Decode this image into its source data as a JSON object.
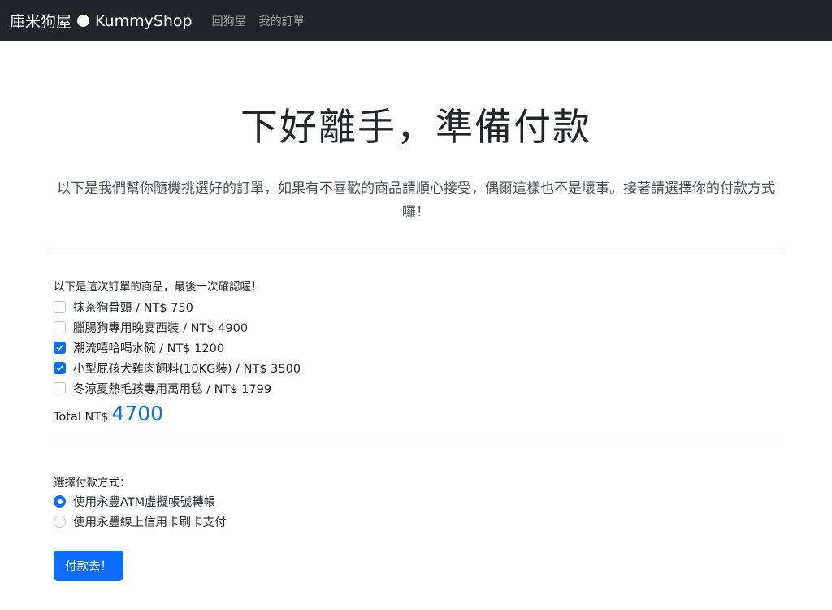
{
  "navbar": {
    "brand_part1": "庫米狗屋",
    "brand_part2": "KummyShop",
    "links": [
      "回狗屋",
      "我的訂單"
    ]
  },
  "hero": {
    "title": "下好離手，準備付款",
    "subtitle": "以下是我們幫你隨機挑選好的訂單，如果有不喜歡的商品請順心接受，偶爾這樣也不是壞事。接著請選擇你的付款方式囉！"
  },
  "order": {
    "label": "以下是這次訂單的商品，最後一次確認喔！",
    "items": [
      {
        "text": "抹茶狗骨頭 / NT$ 750",
        "checked": false
      },
      {
        "text": "臘腸狗專用晚宴西裝 / NT$ 4900",
        "checked": false
      },
      {
        "text": "潮流嘻哈喝水碗 / NT$ 1200",
        "checked": true
      },
      {
        "text": "小型屁孩犬雞肉飼料(10KG裝) / NT$ 3500",
        "checked": true
      },
      {
        "text": "冬涼夏熱毛孩專用萬用毯 / NT$ 1799",
        "checked": false
      }
    ],
    "total_label": "Total NT$",
    "total_value": "4700"
  },
  "payment": {
    "label": "選擇付款方式：",
    "options": [
      {
        "text": "使用永豐ATM虛擬帳號轉帳",
        "selected": true
      },
      {
        "text": "使用永豐線上信用卡刷卡支付",
        "selected": false
      }
    ],
    "button_label": "付款去！"
  },
  "colors": {
    "navbar_bg": "#212529",
    "accent": "#0d6efd"
  }
}
